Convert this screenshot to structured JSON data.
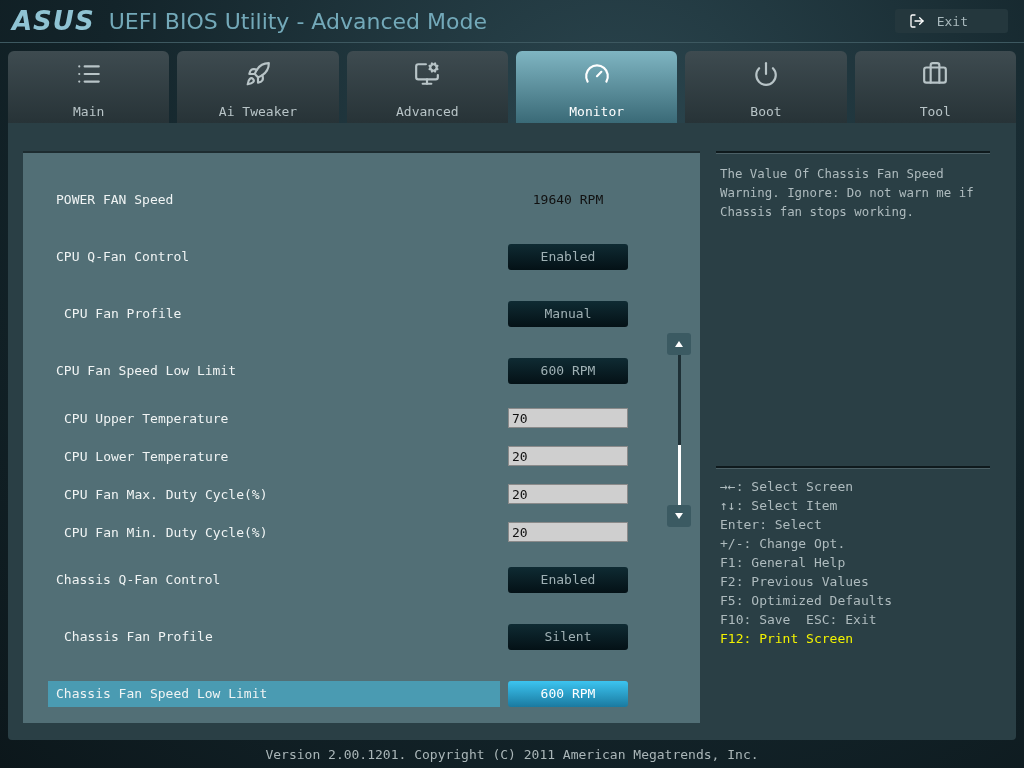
{
  "header": {
    "brand": "ASUS",
    "title": "UEFI BIOS Utility - Advanced Mode",
    "exit_label": "Exit"
  },
  "tabs": [
    {
      "label": "Main",
      "selected": false
    },
    {
      "label": "Ai Tweaker",
      "selected": false
    },
    {
      "label": "Advanced",
      "selected": false
    },
    {
      "label": "Monitor",
      "selected": true
    },
    {
      "label": "Boot",
      "selected": false
    },
    {
      "label": "Tool",
      "selected": false
    }
  ],
  "settings": [
    {
      "kind": "reading",
      "label": "POWER FAN Speed",
      "value": "19640 RPM",
      "selected": false
    },
    {
      "kind": "option",
      "label": "CPU Q-Fan Control",
      "value": "Enabled",
      "selected": false,
      "children": [
        {
          "kind": "option",
          "label": "CPU Fan Profile",
          "value": "Manual",
          "selected": false
        }
      ]
    },
    {
      "kind": "option",
      "label": "CPU Fan Speed Low Limit",
      "value": "600 RPM",
      "selected": false,
      "children": [
        {
          "kind": "number",
          "label": "CPU Upper Temperature",
          "value": "70",
          "selected": false
        },
        {
          "kind": "number",
          "label": "CPU Lower Temperature",
          "value": "20",
          "selected": false
        },
        {
          "kind": "number",
          "label": "CPU Fan Max. Duty Cycle(%)",
          "value": "20",
          "selected": false
        },
        {
          "kind": "number",
          "label": "CPU Fan Min. Duty Cycle(%)",
          "value": "20",
          "selected": false
        }
      ]
    },
    {
      "kind": "option",
      "label": "Chassis Q-Fan Control",
      "value": "Enabled",
      "selected": false,
      "children": [
        {
          "kind": "option",
          "label": "Chassis Fan Profile",
          "value": "Silent",
          "selected": false
        }
      ]
    },
    {
      "kind": "option",
      "label": "Chassis Fan Speed Low Limit",
      "value": "600 RPM",
      "selected": true
    }
  ],
  "help_text": "The Value Of Chassis Fan Speed Warning. Ignore: Do not warn me if Chassis fan stops working.",
  "key_hints": [
    {
      "text": "→←: Select Screen",
      "highlight": false
    },
    {
      "text": "↑↓: Select Item",
      "highlight": false
    },
    {
      "text": "Enter: Select",
      "highlight": false
    },
    {
      "text": "+/-: Change Opt.",
      "highlight": false
    },
    {
      "text": "F1: General Help",
      "highlight": false
    },
    {
      "text": "F2: Previous Values",
      "highlight": false
    },
    {
      "text": "F5: Optimized Defaults",
      "highlight": false
    },
    {
      "text": "F10: Save  ESC: Exit",
      "highlight": false
    },
    {
      "text": "F12: Print Screen",
      "highlight": true
    }
  ],
  "footer": "Version 2.00.1201. Copyright (C) 2011 American Megatrends, Inc."
}
